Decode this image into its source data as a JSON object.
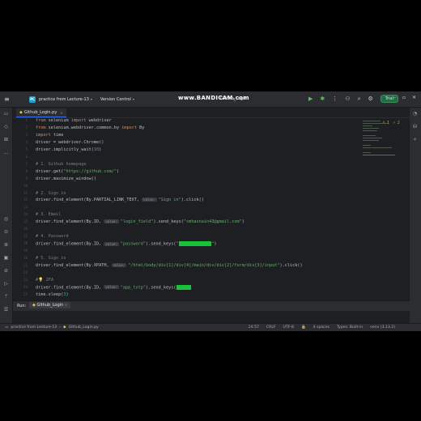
{
  "titlebar": {
    "project_badge": "PC",
    "project_name": "practice from Lecture-13",
    "vcs_label": "Version Control",
    "watermark": "www.BANDICAM.com",
    "run_config": "Github_Login",
    "trial_label": "Trial"
  },
  "tabs": [
    {
      "label": "Github_Login.py"
    }
  ],
  "code_lines": [
    {
      "n": "1",
      "tokens": [
        {
          "t": "kw",
          "v": "from "
        },
        {
          "t": "p",
          "v": "selenium "
        },
        {
          "t": "kw",
          "v": "import "
        },
        {
          "t": "p",
          "v": "webdriver"
        }
      ]
    },
    {
      "n": "2",
      "tokens": [
        {
          "t": "kw",
          "v": "from "
        },
        {
          "t": "p",
          "v": "selenium.webdriver.common.by "
        },
        {
          "t": "kw",
          "v": "import "
        },
        {
          "t": "p",
          "v": "By"
        }
      ]
    },
    {
      "n": "3",
      "tokens": [
        {
          "t": "kw",
          "v": "import "
        },
        {
          "t": "p",
          "v": "time"
        }
      ]
    },
    {
      "n": "4",
      "tokens": [
        {
          "t": "p",
          "v": "driver = webdriver.Chrome()"
        }
      ]
    },
    {
      "n": "5",
      "tokens": [
        {
          "t": "p",
          "v": "driver.implicitly_wait("
        },
        {
          "t": "num",
          "v": "10"
        },
        {
          "t": "p",
          "v": ")"
        }
      ]
    },
    {
      "n": "6",
      "tokens": []
    },
    {
      "n": "7",
      "tokens": [
        {
          "t": "cmt",
          "v": "# 1. Github homepage"
        }
      ]
    },
    {
      "n": "8",
      "tokens": [
        {
          "t": "p",
          "v": "driver.get("
        },
        {
          "t": "str",
          "v": "\"https://github.com/\""
        },
        {
          "t": "p",
          "v": ")"
        }
      ]
    },
    {
      "n": "9",
      "tokens": [
        {
          "t": "p",
          "v": "driver.maximize_window()"
        }
      ]
    },
    {
      "n": "10",
      "tokens": []
    },
    {
      "n": "11",
      "tokens": [
        {
          "t": "cmt",
          "v": "# 2. Sign in"
        }
      ]
    },
    {
      "n": "12",
      "tokens": [
        {
          "t": "p",
          "v": "driver.find_element(By.PARTIAL_LINK_TEXT, "
        },
        {
          "t": "hint",
          "v": "value:"
        },
        {
          "t": "str",
          "v": "\"Sign in\""
        },
        {
          "t": "p",
          "v": ").click()"
        }
      ]
    },
    {
      "n": "13",
      "tokens": []
    },
    {
      "n": "14",
      "tokens": [
        {
          "t": "cmt",
          "v": "# 3. Email"
        }
      ]
    },
    {
      "n": "15",
      "tokens": [
        {
          "t": "p",
          "v": "driver.find_element(By.ID, "
        },
        {
          "t": "hint",
          "v": "value:"
        },
        {
          "t": "str",
          "v": "\"login_field\""
        },
        {
          "t": "p",
          "v": ").send_keys("
        },
        {
          "t": "str",
          "v": "\"smhasnain43@gmail.com\""
        },
        {
          "t": "p",
          "v": ")"
        }
      ]
    },
    {
      "n": "16",
      "tokens": []
    },
    {
      "n": "17",
      "tokens": [
        {
          "t": "cmt",
          "v": "# 4. Password"
        }
      ]
    },
    {
      "n": "18",
      "tokens": [
        {
          "t": "p",
          "v": "driver.find_element(By.ID, "
        },
        {
          "t": "hint",
          "v": "value:"
        },
        {
          "t": "str",
          "v": "\"password\""
        },
        {
          "t": "p",
          "v": ").send_keys("
        },
        {
          "t": "str",
          "v": "\""
        },
        {
          "t": "redact",
          "v": "xxxxxxxxxxxxx"
        },
        {
          "t": "str",
          "v": "\""
        },
        {
          "t": "p",
          "v": ")"
        }
      ]
    },
    {
      "n": "19",
      "tokens": []
    },
    {
      "n": "20",
      "tokens": [
        {
          "t": "cmt",
          "v": "# 5. Sign in"
        }
      ]
    },
    {
      "n": "21",
      "tokens": [
        {
          "t": "p",
          "v": "driver.find_element(By.XPATH, "
        },
        {
          "t": "hint",
          "v": "value:"
        },
        {
          "t": "str",
          "v": "\"/html/body/div[1]/div[4]/main/div/div[2]/form/div[3]/input\""
        },
        {
          "t": "p",
          "v": ").click()"
        }
      ]
    },
    {
      "n": "22",
      "tokens": []
    },
    {
      "n": "23",
      "tokens": [
        {
          "t": "cmt",
          "v": "#💡 2FA"
        }
      ]
    },
    {
      "n": "24",
      "tokens": [
        {
          "t": "p",
          "v": "driver.find_element(By.ID, "
        },
        {
          "t": "hint",
          "v": "value:"
        },
        {
          "t": "str",
          "v": "\"app_totp\""
        },
        {
          "t": "p",
          "v": ").send_keys("
        },
        {
          "t": "redact",
          "v": "xxxxxx"
        }
      ]
    },
    {
      "n": "25",
      "tokens": [
        {
          "t": "p",
          "v": "time.sleep("
        },
        {
          "t": "num",
          "v": "3"
        },
        {
          "t": "p",
          "v": ")"
        }
      ]
    }
  ],
  "editor_status": {
    "warnings": "⚠ 1",
    "ok": "✓ 2"
  },
  "run_panel": {
    "label": "Run:",
    "tab": "Github_Login"
  },
  "statusbar": {
    "breadcrumb_project": "practice from Lecture-13",
    "breadcrumb_file": "Github_Login.py",
    "position": "24:57",
    "line_sep": "CRLF",
    "encoding": "UTF-8",
    "indent": "4 spaces",
    "types": "Types: Built-in",
    "interpreter": "venv (3.13.2)"
  }
}
